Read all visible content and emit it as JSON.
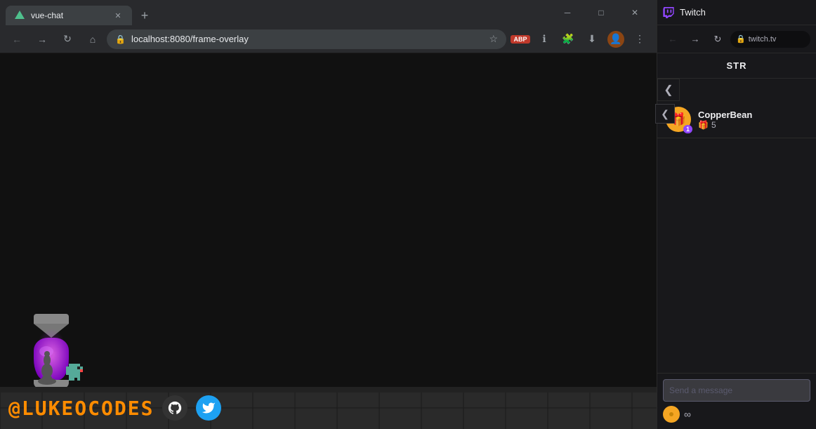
{
  "browser": {
    "tab": {
      "title": "vue-chat",
      "favicon": "V"
    },
    "toolbar": {
      "url": "localhost:8080/frame-overlay",
      "abp_label": "ABP"
    },
    "window_controls": {
      "minimize": "–",
      "maximize": "□",
      "close": "✕"
    }
  },
  "game": {
    "social_name": "@LUKEOCODES",
    "github_icon": "⊛",
    "twitter_icon": "🐦"
  },
  "twitch": {
    "title": "Twitch",
    "url": "twitch.tv",
    "chat_header": "STR",
    "gift": {
      "username": "CopperBean",
      "count": "5",
      "badge": "1"
    },
    "chat_placeholder": "Send a message",
    "coin_icon": "⬡",
    "infinity": "∞"
  }
}
